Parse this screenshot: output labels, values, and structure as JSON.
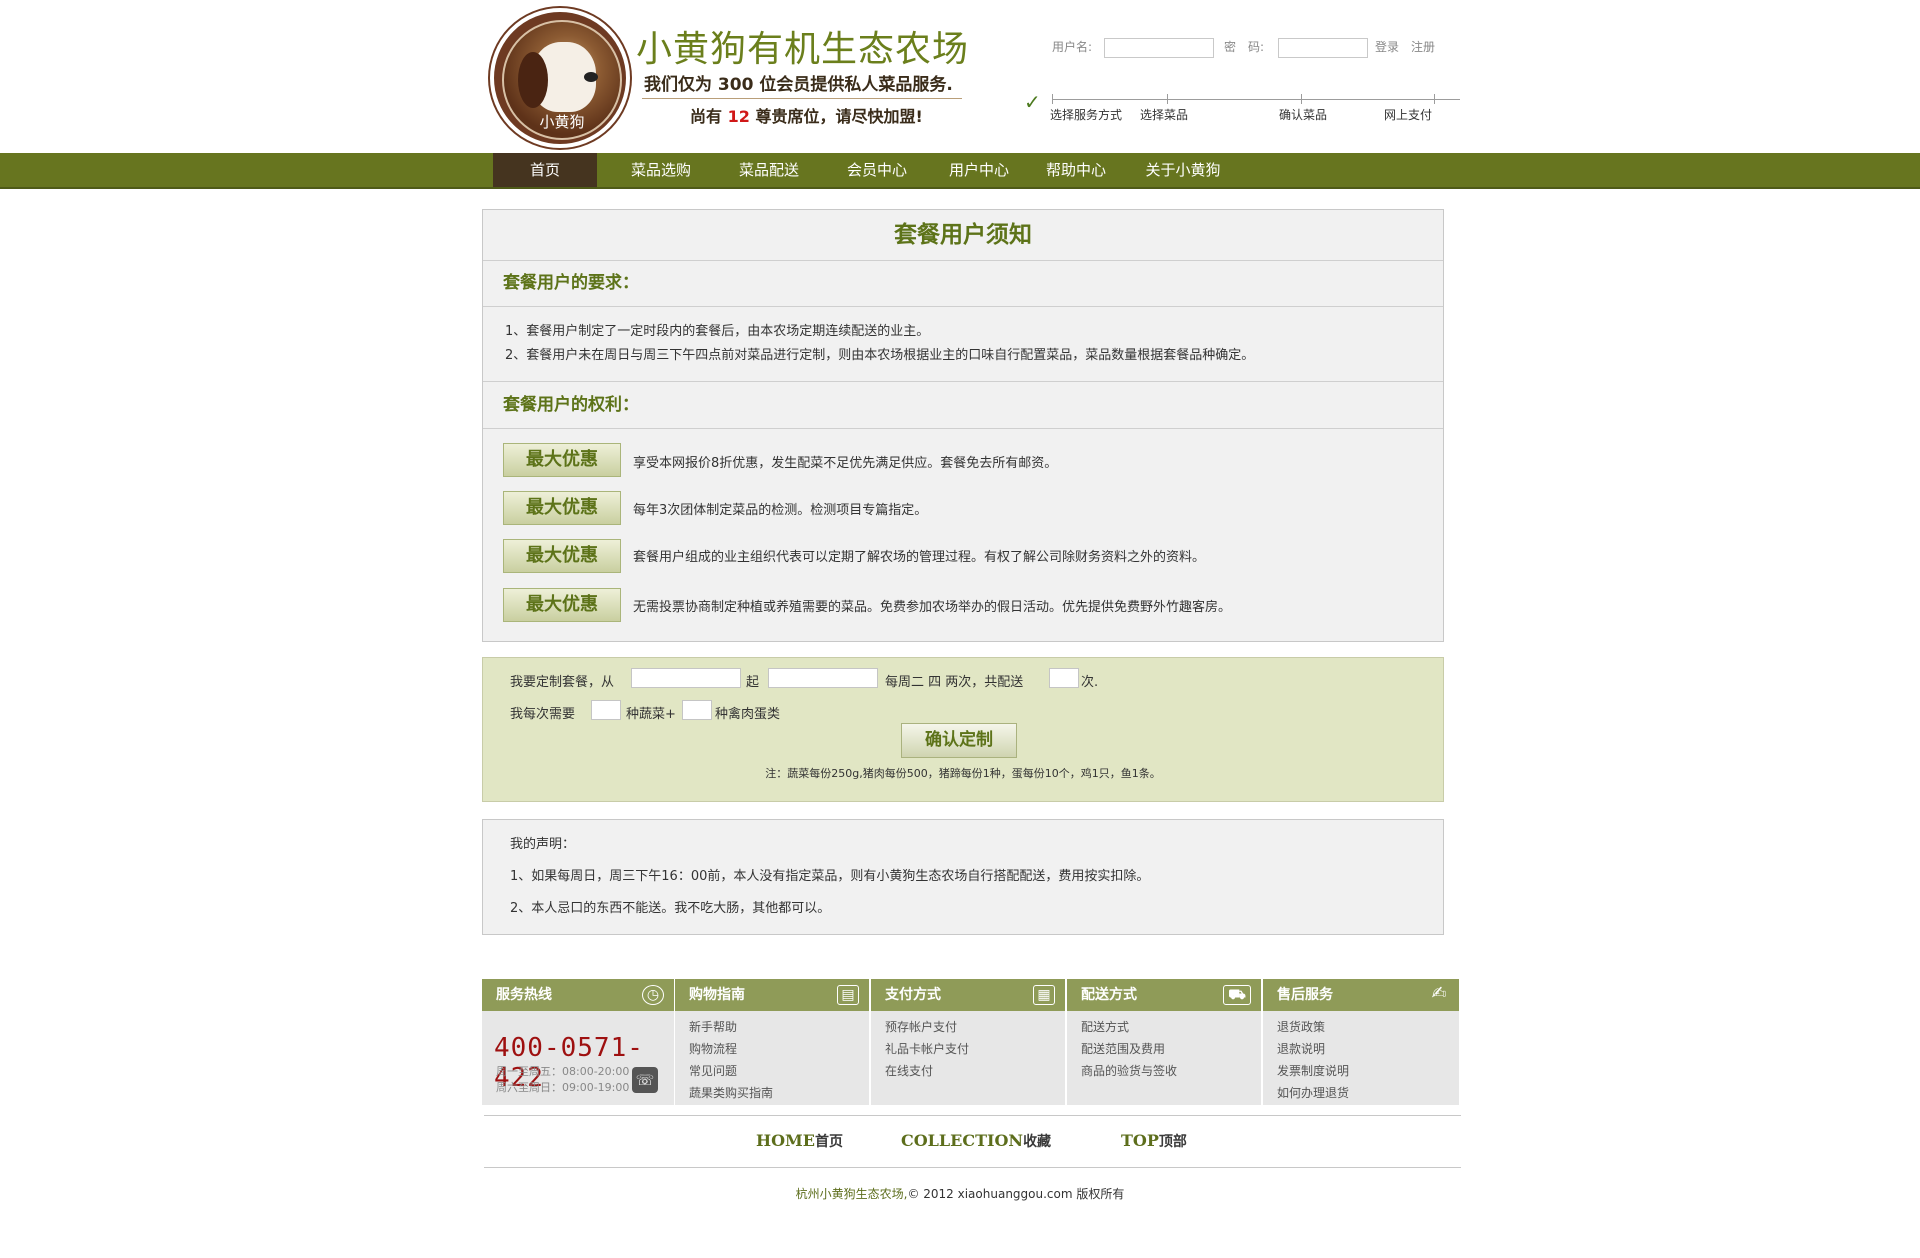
{
  "header": {
    "logo_text": "小黄狗",
    "site_title": "小黄狗有机生态农场",
    "slogan_prefix": "我们仅为",
    "slogan_count": "300",
    "slogan_suffix": "位会员提供私人菜品服务.",
    "seats_prefix": "尚有",
    "seats_count": "12",
    "seats_suffix": "尊贵席位，请尽快加盟!",
    "login": {
      "username_label": "用户名:",
      "password_label": "密　码:",
      "login_link": "登录",
      "register_link": "注册"
    },
    "steps": [
      "选择服务方式",
      "选择菜品",
      "确认菜品",
      "网上支付"
    ]
  },
  "nav": {
    "items": [
      "首页",
      "菜品选购",
      "菜品配送",
      "会员中心",
      "用户中心",
      "帮助中心",
      "关于小黄狗"
    ],
    "active_index": 0
  },
  "notice": {
    "title": "套餐用户须知",
    "requirements_heading": "套餐用户的要求：",
    "requirements": [
      "1、套餐用户制定了一定时段内的套餐后，由本农场定期连续配送的业主。",
      "2、套餐用户未在周日与周三下午四点前对菜品进行定制，则由本农场根据业主的口味自行配置菜品，菜品数量根据套餐品种确定。"
    ],
    "rights_heading": "套餐用户的权利：",
    "rights": [
      {
        "badge": "最大优惠",
        "text": "享受本网报价8折优惠，发生配菜不足优先满足供应。套餐免去所有邮资。"
      },
      {
        "badge": "最大优惠",
        "text": "每年3次团体制定菜品的检测。检测项目专篇指定。"
      },
      {
        "badge": "最大优惠",
        "text": "套餐用户组成的业主组织代表可以定期了解农场的管理过程。有权了解公司除财务资料之外的资料。"
      },
      {
        "badge": "最大优惠",
        "text": "无需投票协商制定种植或养殖需要的菜品。免费参加农场举办的假日活动。优先提供免费野外竹趣客房。"
      }
    ]
  },
  "order_form": {
    "line1_a": "我要定制套餐，从",
    "line1_b": "起",
    "line1_c": "每周二  四 两次，共配送",
    "line1_d": "次.",
    "line2_a": "我每次需要",
    "line2_b": "种蔬菜+",
    "line2_c": "种禽肉蛋类",
    "confirm_button": "确认定制",
    "note": "注：蔬菜每份250g,猪肉每份500，猪蹄每份1种，蛋每份10个，鸡1只，鱼1条。"
  },
  "declaration": {
    "heading": "我的声明：",
    "items": [
      "1、如果每周日，周三下午16：00前，本人没有指定菜品，则有小黄狗生态农场自行搭配配送，费用按实扣除。",
      "2、本人忌口的东西不能送。我不吃大肠，其他都可以。"
    ]
  },
  "footer": {
    "columns": [
      {
        "title": "服务热线",
        "icon": "clock-icon",
        "links": []
      },
      {
        "title": "购物指南",
        "icon": "book-icon",
        "links": [
          "新手帮助",
          "购物流程",
          "常见问题",
          "蔬果类购买指南"
        ]
      },
      {
        "title": "支付方式",
        "icon": "calendar-icon",
        "links": [
          "预存帐户支付",
          "礼品卡帐户支付",
          "在线支付"
        ]
      },
      {
        "title": "配送方式",
        "icon": "truck-icon",
        "links": [
          "配送方式",
          "配送范围及费用",
          "商品的验货与签收"
        ]
      },
      {
        "title": "售后服务",
        "icon": "service-icon",
        "links": [
          "退货政策",
          "退款说明",
          "发票制度说明",
          "如何办理退货"
        ]
      }
    ],
    "hotline": "400-0571-422",
    "hours": [
      "周一至周五：08:00-20:00",
      "周六至周日：09:00-19:00"
    ],
    "bottom_links": [
      {
        "en": "HOME",
        "zh": "首页"
      },
      {
        "en": "COLLECTION",
        "zh": "收藏"
      },
      {
        "en": "TOP",
        "zh": "顶部"
      }
    ],
    "copyright_company": "杭州小黄狗生态农场,",
    "copyright_rest": "© 2012 xiaohuanggou.com 版权所有"
  },
  "colors": {
    "brand_green": "#67751f",
    "nav_active": "#45341f",
    "accent_red": "#d01818"
  }
}
